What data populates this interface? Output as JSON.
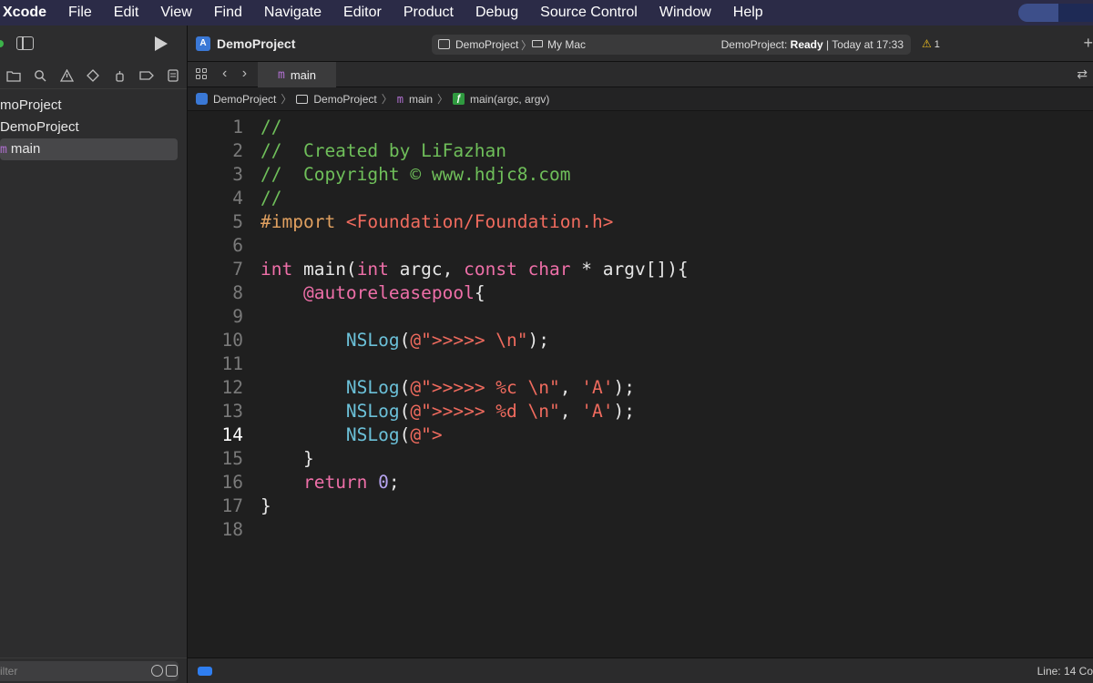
{
  "menubar": {
    "app": "Xcode",
    "items": [
      "File",
      "Edit",
      "View",
      "Find",
      "Navigate",
      "Editor",
      "Product",
      "Debug",
      "Source Control",
      "Window",
      "Help"
    ]
  },
  "navigator": {
    "rows": [
      {
        "label": "moProject"
      },
      {
        "label": "DemoProject"
      },
      {
        "label": "main"
      }
    ],
    "filter_placeholder": "ilter"
  },
  "toolbar": {
    "project_name": "DemoProject",
    "scheme": "DemoProject",
    "destination": "My Mac",
    "status_project": "DemoProject:",
    "status_state": "Ready",
    "status_time": "| Today at 17:33",
    "warning_count": "1"
  },
  "tab": {
    "label": "main"
  },
  "jumpbar": {
    "items": [
      "DemoProject",
      "DemoProject",
      "main",
      "main(argc, argv)"
    ]
  },
  "editor": {
    "current_line": 14,
    "lines": [
      [
        {
          "t": "//",
          "c": "com"
        }
      ],
      [
        {
          "t": "//  Created by LiFazhan",
          "c": "com"
        }
      ],
      [
        {
          "t": "//  Copyright © www.hdjc8.com",
          "c": "com"
        }
      ],
      [
        {
          "t": "//",
          "c": "com"
        }
      ],
      [
        {
          "t": "#import ",
          "c": "mac"
        },
        {
          "t": "<Foundation/Foundation.h>",
          "c": "inc"
        }
      ],
      [],
      [
        {
          "t": "int",
          "c": "kw"
        },
        {
          "t": " main(",
          "c": "plain"
        },
        {
          "t": "int",
          "c": "kw"
        },
        {
          "t": " argc, ",
          "c": "plain"
        },
        {
          "t": "const",
          "c": "kw"
        },
        {
          "t": " ",
          "c": "plain"
        },
        {
          "t": "char",
          "c": "kw"
        },
        {
          "t": " * argv[]){",
          "c": "plain"
        }
      ],
      [
        {
          "t": "    ",
          "c": "plain"
        },
        {
          "t": "@autoreleasepool",
          "c": "kw"
        },
        {
          "t": "{",
          "c": "plain"
        }
      ],
      [],
      [
        {
          "t": "        ",
          "c": "plain"
        },
        {
          "t": "NSLog",
          "c": "fn"
        },
        {
          "t": "(",
          "c": "plain"
        },
        {
          "t": "@\">>>>> \\n\"",
          "c": "str"
        },
        {
          "t": ");",
          "c": "plain"
        }
      ],
      [],
      [
        {
          "t": "        ",
          "c": "plain"
        },
        {
          "t": "NSLog",
          "c": "fn"
        },
        {
          "t": "(",
          "c": "plain"
        },
        {
          "t": "@\">>>>> %c \\n\"",
          "c": "str"
        },
        {
          "t": ", ",
          "c": "plain"
        },
        {
          "t": "'A'",
          "c": "str"
        },
        {
          "t": ");",
          "c": "plain"
        }
      ],
      [
        {
          "t": "        ",
          "c": "plain"
        },
        {
          "t": "NSLog",
          "c": "fn"
        },
        {
          "t": "(",
          "c": "plain"
        },
        {
          "t": "@\">>>>> %d \\n\"",
          "c": "str"
        },
        {
          "t": ", ",
          "c": "plain"
        },
        {
          "t": "'A'",
          "c": "str"
        },
        {
          "t": ");",
          "c": "plain"
        }
      ],
      [
        {
          "t": "        ",
          "c": "plain"
        },
        {
          "t": "NSLog",
          "c": "fn"
        },
        {
          "t": "(",
          "c": "plain"
        },
        {
          "t": "@\">",
          "c": "str"
        }
      ],
      [
        {
          "t": "    }",
          "c": "plain"
        }
      ],
      [
        {
          "t": "    ",
          "c": "plain"
        },
        {
          "t": "return",
          "c": "kw"
        },
        {
          "t": " ",
          "c": "plain"
        },
        {
          "t": "0",
          "c": "num"
        },
        {
          "t": ";",
          "c": "plain"
        }
      ],
      [
        {
          "t": "}",
          "c": "plain"
        }
      ],
      []
    ]
  },
  "statusbar": {
    "position": "Line: 14  Co"
  },
  "colors": {
    "menubar_bg": "#2b2b47",
    "comment": "#6fbf5a",
    "keyword": "#ee6fa8",
    "string": "#f06b5e",
    "function": "#6bc0d8",
    "number": "#b7a4f0",
    "accent": "#2f7ef0"
  }
}
